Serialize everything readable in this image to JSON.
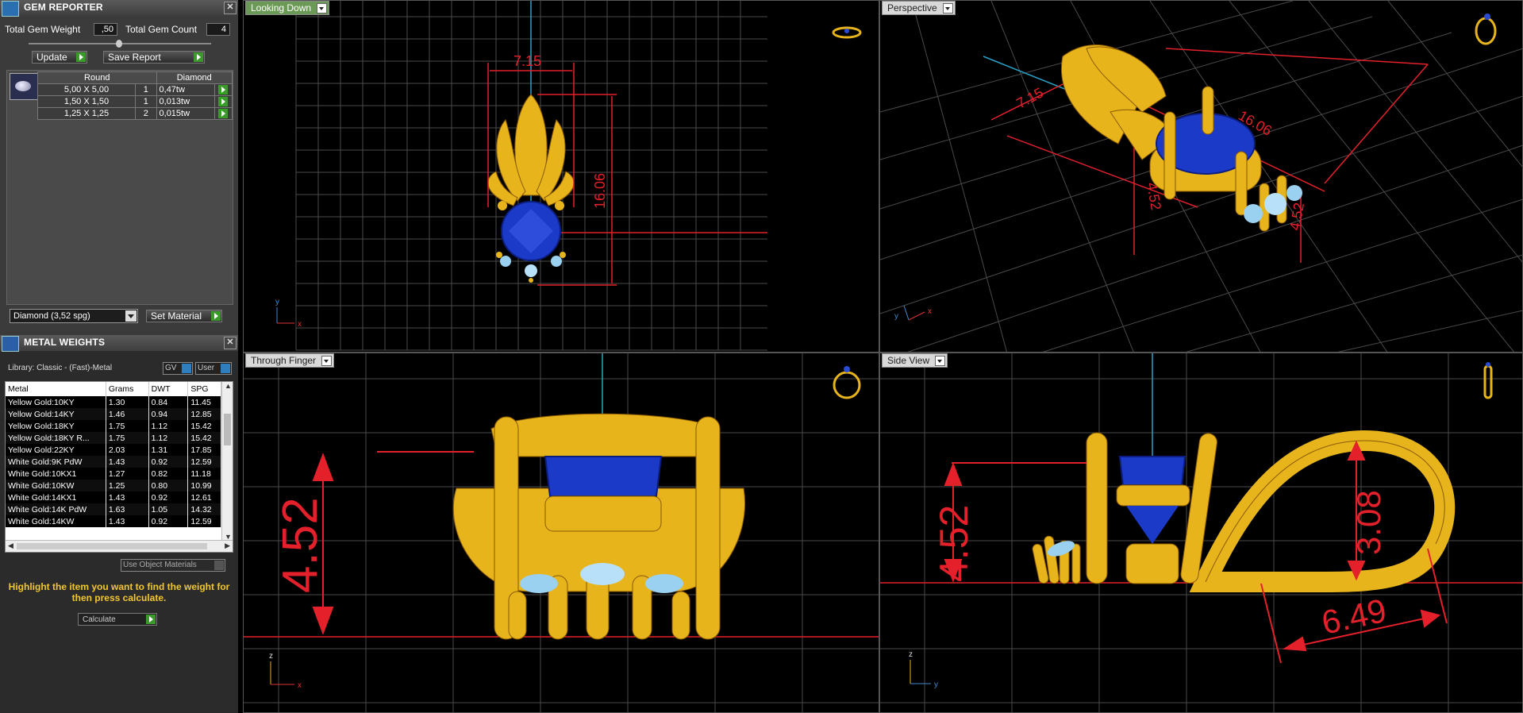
{
  "gem_reporter": {
    "title": "GEM REPORTER",
    "total_weight_label": "Total Gem Weight",
    "total_weight_value": ",50",
    "total_count_label": "Total Gem Count",
    "total_count_value": "4",
    "update_label": "Update",
    "save_label": "Save Report",
    "table": {
      "headers": [
        "Round",
        "Diamond"
      ],
      "rows": [
        {
          "size": "5,00 X 5,00",
          "qty": "1",
          "weight": "0,47tw"
        },
        {
          "size": "1,50 X 1,50",
          "qty": "1",
          "weight": "0,013tw"
        },
        {
          "size": "1,25 X 1,25",
          "qty": "2",
          "weight": "0,015tw"
        }
      ]
    },
    "material_select": "Diamond    (3,52 spg)",
    "set_material_label": "Set Material"
  },
  "metal_weights": {
    "title": "METAL WEIGHTS",
    "library": "Library: Classic - (Fast)-Metal",
    "gv_label": "GV",
    "user_label": "User",
    "columns": [
      "Metal",
      "Grams",
      "DWT",
      "SPG"
    ],
    "rows": [
      [
        "Yellow Gold:10KY",
        "1.30",
        "0.84",
        "11.45"
      ],
      [
        "Yellow Gold:14KY",
        "1.46",
        "0.94",
        "12.85"
      ],
      [
        "Yellow Gold:18KY",
        "1.75",
        "1.12",
        "15.42"
      ],
      [
        "Yellow Gold:18KY R...",
        "1.75",
        "1.12",
        "15.42"
      ],
      [
        "Yellow Gold:22KY",
        "2.03",
        "1.31",
        "17.85"
      ],
      [
        "White Gold:9K PdW",
        "1.43",
        "0.92",
        "12.59"
      ],
      [
        "White Gold:10KX1",
        "1.27",
        "0.82",
        "11.18"
      ],
      [
        "White Gold:10KW",
        "1.25",
        "0.80",
        "10.99"
      ],
      [
        "White Gold:14KX1",
        "1.43",
        "0.92",
        "12.61"
      ],
      [
        "White Gold:14K PdW",
        "1.63",
        "1.05",
        "14.32"
      ],
      [
        "White Gold:14KW",
        "1.43",
        "0.92",
        "12.59"
      ]
    ],
    "use_object_materials": "Use Object Materials",
    "hint": "Highlight the item you want to find the weight for then press calculate.",
    "calculate_label": "Calculate"
  },
  "viewports": {
    "top_left": {
      "label": "Looking Down",
      "dim1": "7.15",
      "dim2": "16.06",
      "axis_y": "y",
      "axis_x": "x"
    },
    "top_right": {
      "label": "Perspective",
      "dim1": "7.15",
      "dim2": "16.06",
      "dim3": "4.52",
      "dim4": "4.52",
      "axis_y": "y",
      "axis_x": "x"
    },
    "bottom_left": {
      "label": "Through Finger",
      "dim1": "4.52",
      "axis_z": "z",
      "axis_x": "x"
    },
    "bottom_right": {
      "label": "Side View",
      "dim1": "4.52",
      "dim2": "3.08",
      "dim3": "6.49",
      "axis_z": "z",
      "axis_y": "y"
    }
  },
  "colors": {
    "gold": "#e8b41c",
    "gem_blue": "#1c3ac8",
    "dim_red": "#e4202a",
    "grid": "#5a5a5a"
  }
}
